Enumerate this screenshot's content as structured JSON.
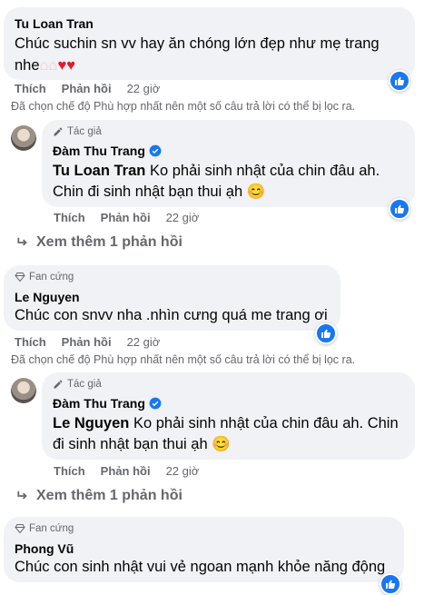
{
  "comments": [
    {
      "name": "Tu Loan Tran",
      "text": "Chúc suchin sn vv hay ăn chóng lớn đẹp như mẹ trang",
      "text2": "nhe",
      "emoji": "🎂🎂❤❤",
      "actions": {
        "like": "Thích",
        "reply": "Phản hồi",
        "time": "22 giờ"
      },
      "note": "Đã chọn chế độ Phù hợp nhất nên một số câu trả lời có thể bị lọc ra."
    },
    {
      "badge": "Tác giả",
      "name": "Đàm Thu Trang",
      "mention": "Tu Loan Tran",
      "text": " Ko phải sinh nhật của chin đâu ah.",
      "text2": "Chin đi sinh nhật bạn thui ạh",
      "emoji": "😊",
      "actions": {
        "like": "Thích",
        "reply": "Phản hồi",
        "time": "22 giờ"
      }
    },
    {
      "more": "Xem thêm 1 phản hồi"
    },
    {
      "badge": "Fan cứng",
      "name": "Le Nguyen",
      "text": "Chúc con snvv nha .nhìn cưng quá me trang ơi",
      "actions": {
        "like": "Thích",
        "reply": "Phản hồi",
        "time": "22 giờ"
      },
      "note": "Đã chọn chế độ Phù hợp nhất nên một số câu trả lời có thể bị lọc ra."
    },
    {
      "badge": "Tác giả",
      "name": "Đàm Thu Trang",
      "mention": "Le Nguyen",
      "text": " Ko phải sinh nhật của chin đâu ah. Chin",
      "text2": "đi sinh nhật bạn thui ạh",
      "emoji": "😊",
      "actions": {
        "like": "Thích",
        "reply": "Phản hồi",
        "time": "22 giờ"
      }
    },
    {
      "more": "Xem thêm 1 phản hồi"
    },
    {
      "badge": "Fan cứng",
      "name": "Phong Vũ",
      "text": "Chúc con sinh nhật vui vẻ ngoan mạnh khỏe năng động"
    }
  ],
  "colors": {
    "bubble": "#f0f2f5",
    "like_blue": "#1877f2",
    "meta": "#65676b",
    "verified": "#1877f2"
  },
  "icons": [
    "pencil-icon",
    "diamond-icon",
    "verified-icon",
    "thumbs-up-icon",
    "reply-arrow-icon"
  ]
}
